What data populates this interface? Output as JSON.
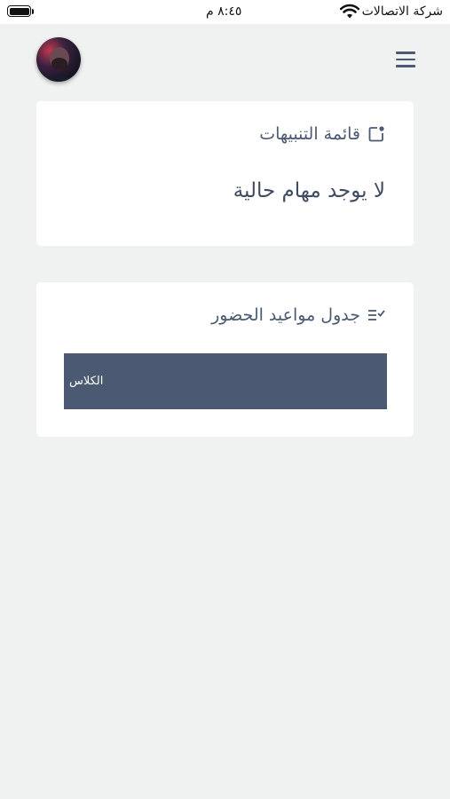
{
  "status_bar": {
    "carrier": "شركة الاتصالات",
    "time": "٨:٤٥ م"
  },
  "header": {
    "avatar": "user-avatar",
    "menu_icon": "hamburger-menu-icon"
  },
  "notifications": {
    "title": "قائمة التنبيهات",
    "icon": "notification-icon",
    "empty_message": "لا يوجد مهام حالية"
  },
  "schedule": {
    "title": "جدول مواعيد الحضور",
    "icon": "checklist-icon",
    "class_button_label": "الكلاس"
  },
  "colors": {
    "background": "#f0f2f2",
    "card": "#ffffff",
    "accent": "#4b5a72",
    "text": "#4b5a72"
  }
}
